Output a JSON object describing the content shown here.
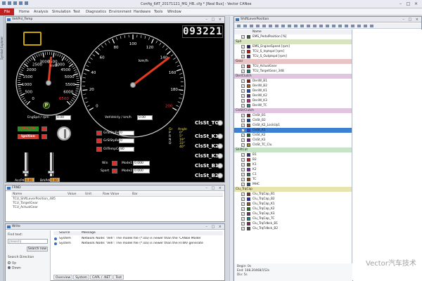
{
  "app": {
    "window_title": "Config_6AT_20171121_MG_HB..cfg * [Real Bus] - Vector CANoe",
    "file_label": "File",
    "menus": [
      "Home",
      "Analysis",
      "Simulation",
      "Test",
      "Diagnostics",
      "Environment",
      "Hardware",
      "Tools",
      "Window"
    ],
    "left_tab": "Symbol Explorer"
  },
  "panel_window": {
    "title": "VehPnl_Temp",
    "odometer": "093221",
    "engine_gauge": {
      "ticks": [
        "0",
        "500",
        "1000",
        "1500",
        "2000",
        "2500",
        "3000",
        "3500",
        "4000",
        "4500",
        "5000",
        "5500",
        "6000",
        "6500"
      ],
      "unit": "r/min",
      "value_fraction": 0.52,
      "label": "EngSpd / rpm",
      "readout": "0.00"
    },
    "gear_indicator": "P",
    "speed_gauge": {
      "ticks": [
        "0",
        "20",
        "40",
        "60",
        "80",
        "100",
        "120",
        "140",
        "160",
        "180",
        "200"
      ],
      "unit": "km/h",
      "value_fraction": 0.72,
      "label": "VehVelcty / km/h",
      "readout": "0.00"
    },
    "controls": {
      "key_on": "KEY_ON",
      "ignition": "Ignition",
      "gr_sel_stp": "GrSlStpReq",
      "gr_sel_req": "GrSlStpReq",
      "oil_temp": "OilTempCels",
      "oil_temp_value": "80",
      "win_label": "Win",
      "sport_label": "Sport",
      "mode1": "Mode1",
      "mode2": "Mode2",
      "mode1_value": "0.000",
      "mode2_value": "0.000",
      "gr_sel_val1": "0",
      "gr_sel_val2": "0",
      "acc_pdl": "AccPdl",
      "brk_pdl": "BrkPdl",
      "acc_value": "0.00",
      "brk_value": "0.00"
    },
    "gear_table": {
      "header": [
        "Gr",
        "Angle"
      ],
      "rows": [
        [
          "P",
          "0°"
        ],
        [
          "R",
          "5°"
        ],
        [
          "N",
          "19°"
        ],
        [
          "D",
          "33°"
        ],
        [
          "",
          "40°"
        ]
      ]
    },
    "clutch_labels": [
      "ClsSt_TC",
      "ClsSt_K1",
      "ClsSt_K2",
      "ClsSt_K3",
      "ClsSt_B1",
      "ClsSt_B2"
    ]
  },
  "frnd_window": {
    "title": "FRND",
    "columns": [
      "Name",
      "Value",
      "Unit",
      "Raw Value",
      "Bar"
    ],
    "rows": [
      "TCU_ShftLeverPosition_485",
      "TCU_TargetGear",
      "TCU_ActualGear"
    ]
  },
  "write_window": {
    "title": "Write",
    "find_label": "Find text:",
    "find_placeholder": "(Search)",
    "search_button": "Search now",
    "direction_label": "Search Direction",
    "direction_up": "Up",
    "direction_down": "Down",
    "columns": [
      "Source",
      "Message"
    ],
    "messages": [
      [
        "System",
        "Network Node: 'Veh': The model file (*.sla) is newer than the 'CANoe Model"
      ],
      [
        "System",
        "Network Node: 'Veh': The model file (*.sla) is newer than the RTWV generate"
      ]
    ],
    "tabs": [
      "Overview",
      "System",
      "CAPL / .NET",
      "Test"
    ]
  },
  "signal_window": {
    "title": "ShiftLeverPosition",
    "header_name": "Name",
    "groups": [
      {
        "name": "",
        "color": "#ffffff",
        "items": [
          [
            "EMS_PedalPosition [%]",
            "#2d6e2d"
          ]
        ]
      },
      {
        "name": "Spd",
        "color": "#d8e4c0",
        "items": [
          [
            "EMS_EngineSpeed [rpm]",
            "#1a1a8c"
          ],
          [
            "TCU_S_Inptspd [rpm]",
            "#b0201f"
          ],
          [
            "TCU_S_Outptspd [rpm]",
            "#4a2a8c"
          ]
        ]
      },
      {
        "name": "Gear",
        "color": "#e8c4c4",
        "items": [
          [
            "TCU_ActualGear",
            "#c03030"
          ],
          [
            "TCU_TargetGear_348",
            "#2a7a7a"
          ]
        ]
      },
      {
        "name": "DeriClutch",
        "color": "#e0c4e0",
        "items": [
          [
            "DeriW_B1",
            "#7a1a1a"
          ],
          [
            "DeriW_B2",
            "#b05a10"
          ],
          [
            "DeriW_K1",
            "#2a4a9a"
          ],
          [
            "DeriW_K2",
            "#5a2a8a"
          ],
          [
            "DeriW_K3",
            "#aa2a7a"
          ],
          [
            "DeriW_TC",
            "#2a8a8a"
          ]
        ]
      },
      {
        "name": "ClsSt/Clutch",
        "color": "#e0c4e0",
        "items": [
          [
            "ClsSt_B1",
            "#8a1a1a"
          ],
          [
            "ClsSt_B2",
            "#1a3a8a"
          ],
          [
            "ClsSt_K2_LockUp1",
            "#9a4a1a"
          ],
          [
            "ClsSt_K1",
            "#3a3aaa"
          ],
          [
            "ClsSt_K2",
            "#1a6a1a"
          ],
          [
            "ClsSt_K3",
            "#6a1a6a"
          ],
          [
            "ClsSt_TC_Clu",
            "#aa8a1a"
          ]
        ]
      },
      {
        "name": "ShiftCat",
        "color": "#c8e4c8",
        "items": [
          [
            "B1",
            "#2a2a9a"
          ],
          [
            "B2",
            "#9a2a2a"
          ],
          [
            "K1",
            "#4a6a1a"
          ],
          [
            "K2",
            "#6a2a8a"
          ],
          [
            "C1",
            "#2a7a5a"
          ],
          [
            "TC",
            "#7a4a1a"
          ],
          [
            "MHC",
            "#1a4a7a"
          ]
        ]
      },
      {
        "name": "Clu_TrqCap",
        "color": "#e8e4b0",
        "items": [
          [
            "Clu_TrqCap_B1",
            "#8a2a2a"
          ],
          [
            "Clu_TrqCap_B2",
            "#2a2a9a"
          ],
          [
            "Clu_TrqCap_K1",
            "#9a5a1a"
          ],
          [
            "Clu_TrqCap_K2",
            "#2a6a2a"
          ],
          [
            "Clu_TrqCap_K3",
            "#6a2a8a"
          ],
          [
            "Clu_TrqCap_TC",
            "#2a7a7a"
          ],
          [
            "Clu_TrqFdbck_B1",
            "#8a1a5a"
          ],
          [
            "Clu_TrqFdbck_B2",
            "#4a4a4a"
          ]
        ]
      }
    ],
    "footer": [
      "Begin: 0s",
      "End: 108.20468/152s",
      "Div: 5s"
    ]
  },
  "watermark": "Vector汽车技术"
}
